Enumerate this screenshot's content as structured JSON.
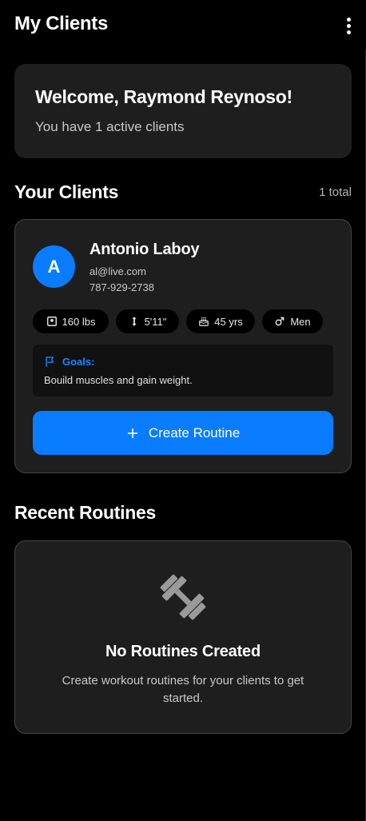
{
  "appbar": {
    "title": "My Clients",
    "menu_icon": "more-vert-icon"
  },
  "welcome": {
    "title": "Welcome, Raymond Reynoso!",
    "subtitle": "You have 1 active clients"
  },
  "clients_section": {
    "title": "Your Clients",
    "count": "1 total"
  },
  "clients": [
    {
      "initial": "A",
      "name": "Antonio Laboy",
      "email": "al@live.com",
      "phone": "787-929-2738",
      "stats": {
        "weight": "160 lbs",
        "height": "5'11\"",
        "age": "45 yrs",
        "gender": "Men"
      },
      "goals_label": "Goals:",
      "goals_text": "Bouild muscles and gain weight.",
      "create_button": "Create Routine"
    }
  ],
  "routines_section": {
    "title": "Recent Routines",
    "empty_title": "No Routines Created",
    "empty_subtitle": "Create workout routines for your clients to get started.",
    "empty_icon": "dumbbell-icon"
  },
  "colors": {
    "background": "#000000",
    "card": "#1e1e1e",
    "accent": "#0a7cff",
    "card_border": "#454545"
  }
}
